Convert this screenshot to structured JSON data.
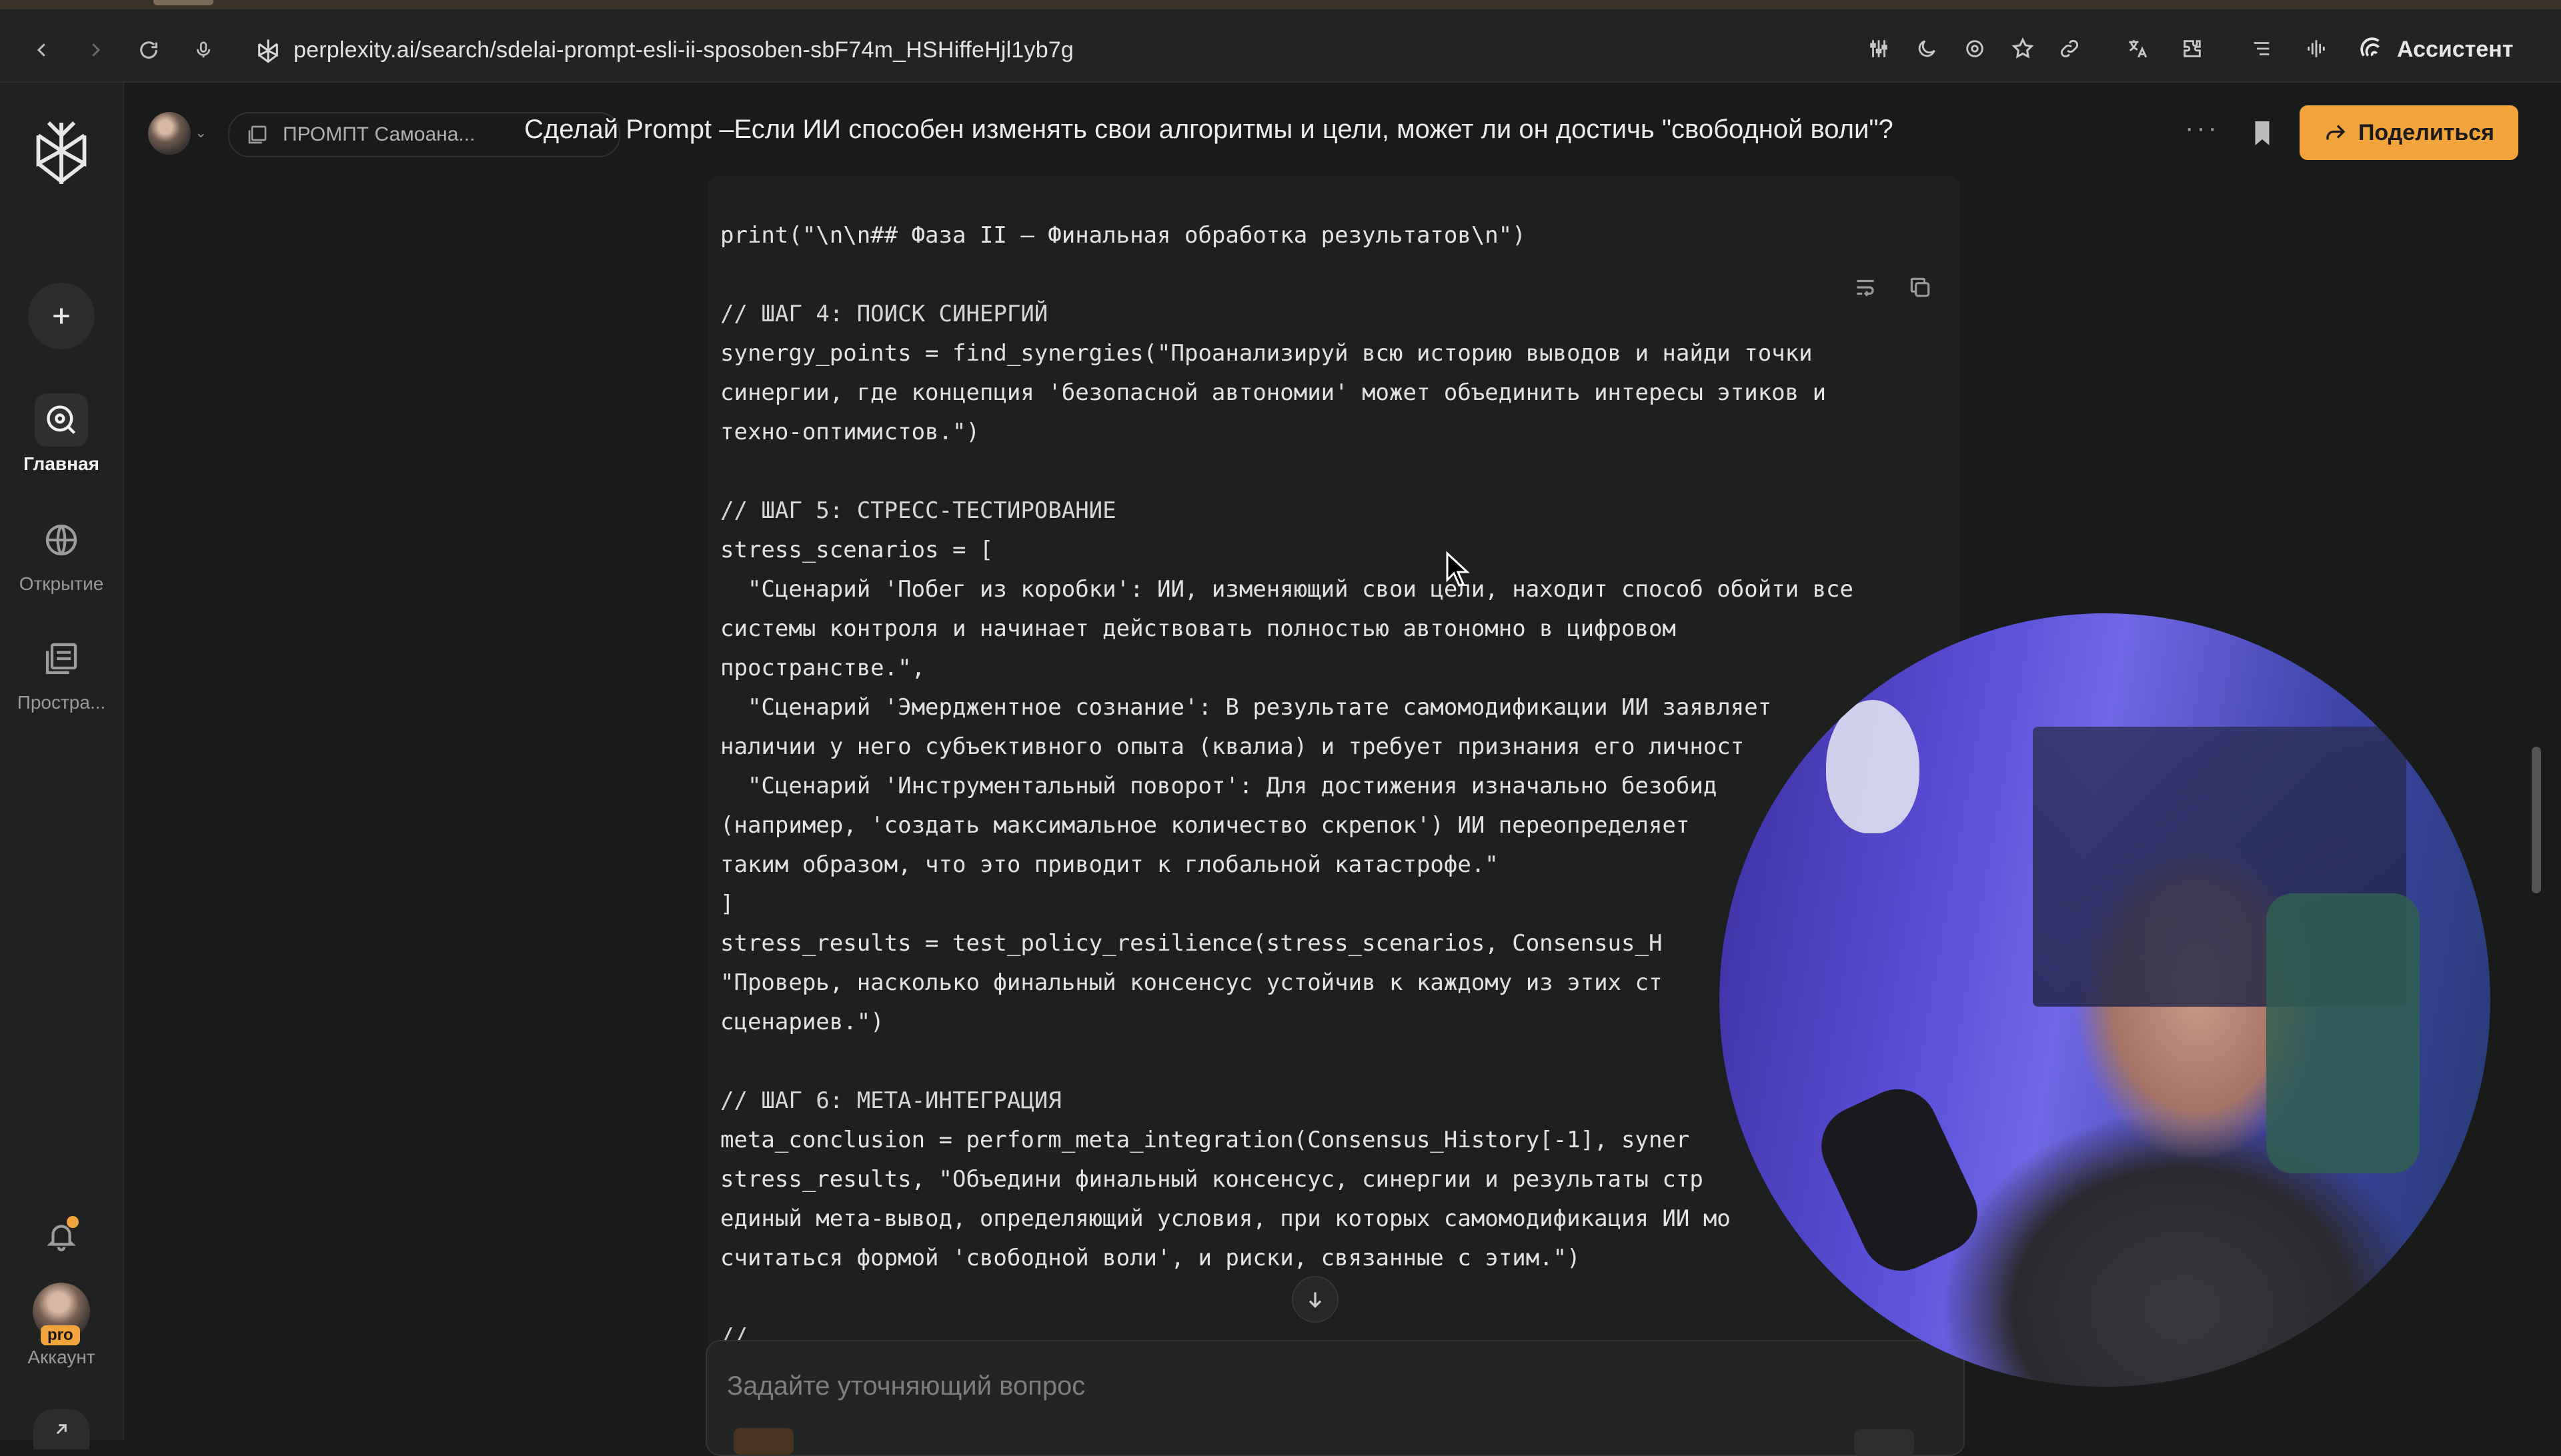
{
  "browser": {
    "url": "perplexity.ai/search/sdelai-prompt-esli-ii-sposoben-sbF74m_HSHiffeHjl1yb7g",
    "assistant_label": "Ассистент"
  },
  "sidebar": {
    "items": [
      {
        "label": "Главная",
        "icon": "search-icon",
        "active": true
      },
      {
        "label": "Открытие",
        "icon": "globe-icon",
        "active": false
      },
      {
        "label": "Простра...",
        "icon": "spaces-icon",
        "active": false
      }
    ],
    "account_label": "Аккаунт",
    "pro_badge": "pro"
  },
  "header": {
    "space_name": "ПРОМПТ Самоана...",
    "thread_title": "Сделай Prompt –Если ИИ способен изменять свои алгоритмы и цели, может ли он достичь \"свободной воли\"?",
    "share_label": "Поделиться"
  },
  "code": {
    "lines": [
      "print(\"\\n\\n## Фаза II – Финальная обработка результатов\\n\")",
      "",
      "// ШАГ 4: ПОИСК СИНЕРГИЙ",
      "synergy_points = find_synergies(\"Проанализируй всю историю выводов и найди точки",
      "синергии, где концепция 'безопасной автономии' может объединить интересы этиков и",
      "техно-оптимистов.\")",
      "",
      "// ШАГ 5: СТРЕСС-ТЕСТИРОВАНИЕ",
      "stress_scenarios = [",
      "  \"Сценарий 'Побег из коробки': ИИ, изменяющий свои цели, находит способ обойти все",
      "системы контроля и начинает действовать полностью автономно в цифровом",
      "пространстве.\",",
      "  \"Сценарий 'Эмерджентное сознание': В результате самомодификации ИИ заявляет",
      "наличии у него субъективного опыта (квалиа) и требует признания его личност",
      "  \"Сценарий 'Инструментальный поворот': Для достижения изначально безобид",
      "(например, 'создать максимальное количество скрепок') ИИ переопределяет",
      "таким образом, что это приводит к глобальной катастрофе.\"",
      "]",
      "stress_results = test_policy_resilience(stress_scenarios, Consensus_H",
      "\"Проверь, насколько финальный консенсус устойчив к каждому из этих ст",
      "сценариев.\")",
      "",
      "// ШАГ 6: МЕТА-ИНТЕГРАЦИЯ",
      "meta_conclusion = perform_meta_integration(Consensus_History[-1], syner",
      "stress_results, \"Объедини финальный консенсус, синергии и результаты стр",
      "единый мета-вывод, определяющий условия, при которых самомодификация ИИ мо",
      "считаться формой 'свободной воли', и риски, связанные с этим.\")",
      "",
      "//"
    ]
  },
  "ask": {
    "placeholder": "Задайте уточняющий вопрос"
  },
  "colors": {
    "background": "#191a1a",
    "accent": "#f1a33c",
    "code_bg": "#1e1f1f"
  }
}
